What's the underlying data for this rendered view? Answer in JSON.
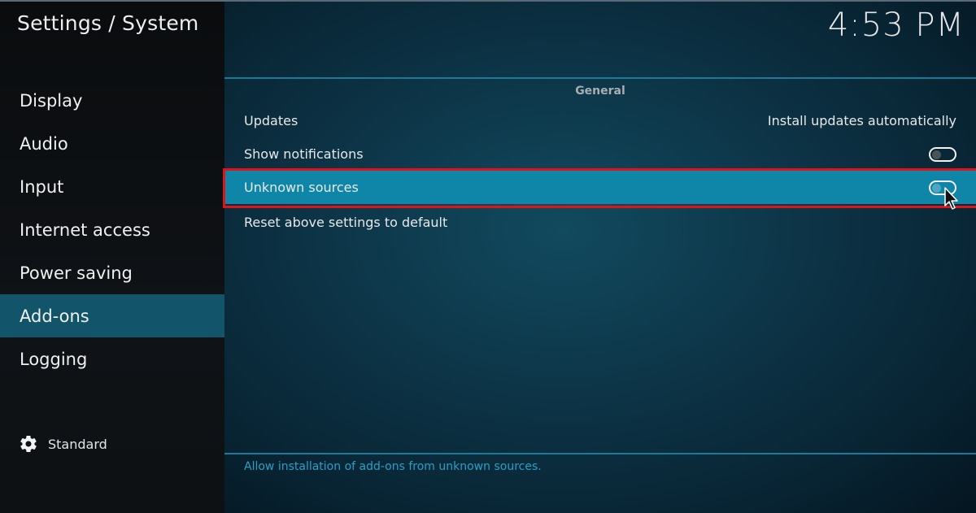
{
  "header": {
    "title": "Settings / System",
    "clock": "4:53 PM"
  },
  "sidebar": {
    "items": [
      {
        "label": "Display",
        "active": false
      },
      {
        "label": "Audio",
        "active": false
      },
      {
        "label": "Input",
        "active": false
      },
      {
        "label": "Internet access",
        "active": false
      },
      {
        "label": "Power saving",
        "active": false
      },
      {
        "label": "Add-ons",
        "active": true
      },
      {
        "label": "Logging",
        "active": false
      }
    ],
    "profile": {
      "icon": "gear-icon",
      "label": "Standard"
    }
  },
  "main": {
    "section": "General",
    "settings": [
      {
        "label": "Updates",
        "value": "Install updates automatically",
        "type": "select"
      },
      {
        "label": "Show notifications",
        "type": "toggle",
        "enabled": false
      },
      {
        "label": "Unknown sources",
        "type": "toggle",
        "enabled": false,
        "selected": true
      },
      {
        "label": "Reset above settings to default",
        "type": "action"
      }
    ],
    "description": "Allow installation of add-ons from unknown sources."
  },
  "colors": {
    "accent": "#0f86a8",
    "sidebar_active": "#12556b",
    "highlight_border": "#e0121a",
    "description_text": "#2a9fc4"
  }
}
